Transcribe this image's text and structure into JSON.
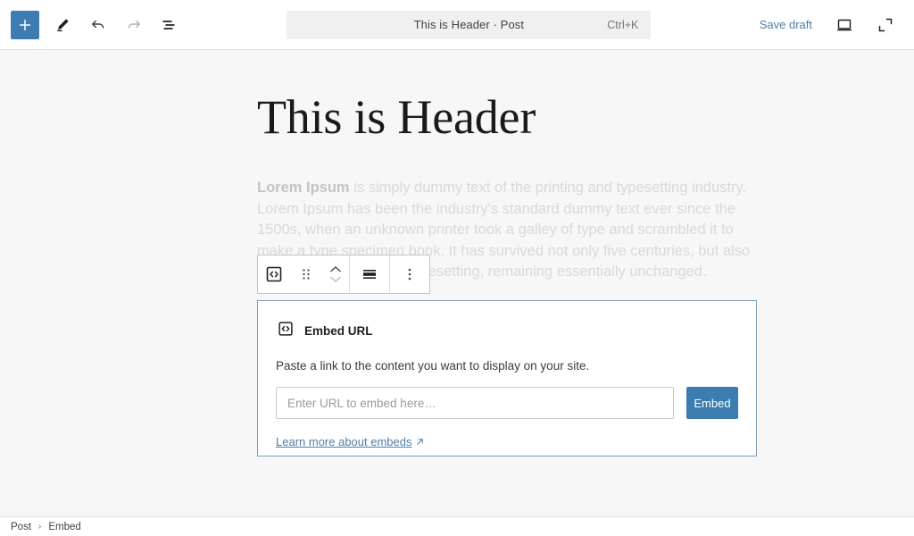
{
  "topbar": {
    "add_block_label": "+",
    "add_block_icon": "plus-icon",
    "edit_icon": "pencil-icon",
    "undo_icon": "undo-icon",
    "redo_icon": "redo-icon",
    "list_view_icon": "list-view-icon",
    "command_bar": {
      "title": "This is Header · Post",
      "shortcut": "Ctrl+K"
    },
    "save_draft_label": "Save draft",
    "preview_icon": "desktop-preview-icon",
    "fullscreen_icon": "expand-icon"
  },
  "editor": {
    "post_title": "This is Header",
    "paragraph_lead": "Lorem Ipsum",
    "paragraph_rest": " is simply dummy text of the printing and typesetting industry. Lorem Ipsum has been the industry's standard dummy text ever since the 1500s, when an unknown printer took a galley of type and scrambled it to make a type specimen book. It has survived not only five centuries, but also the leap into electronic typesetting, remaining essentially unchanged."
  },
  "block_toolbar": {
    "block_type_icon": "embed-block-icon",
    "drag_handle_icon": "drag-handle-icon",
    "move_up_icon": "chevron-up-icon",
    "move_down_icon": "chevron-down-icon",
    "align_icon": "align-wide-icon",
    "more_options_icon": "three-dots-vertical-icon"
  },
  "embed_block": {
    "icon": "embed-block-icon",
    "heading": "Embed URL",
    "description": "Paste a link to the content you want to display on your site.",
    "url_placeholder": "Enter URL to embed here…",
    "url_value": "",
    "submit_label": "Embed",
    "learn_more_label": "Learn more about embeds",
    "external_link_icon": "external-link-icon"
  },
  "footer": {
    "breadcrumbs": [
      {
        "label": "Post"
      },
      {
        "label": "Embed"
      }
    ],
    "separator": "›"
  },
  "colors": {
    "accent_blue": "#3d7cb0",
    "link_blue": "#4d7fa8",
    "card_border": "#7ea0b5",
    "canvas_bg": "#f7f7f7",
    "faded_text": "#d9d9d9"
  }
}
